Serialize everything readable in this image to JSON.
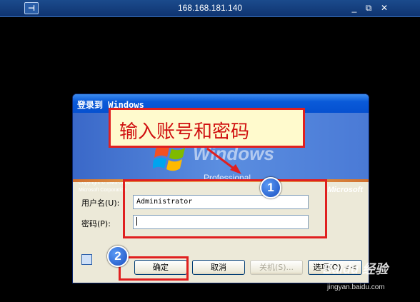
{
  "remote_bar": {
    "host": "168.168.181.140",
    "pin_icon": "pin-icon",
    "minimize_glyph": "_",
    "restore_glyph": "⧉",
    "close_glyph": "✕"
  },
  "dialog": {
    "title": "登录到 Windows",
    "banner": {
      "product_word": "Windows",
      "edition": "Professional",
      "copyright_line1": "Copyright © 1985-2001",
      "copyright_line2": "Microsoft Corporation",
      "brand": "Microsoft"
    },
    "username_label": "用户名(U):",
    "username_value": "Administrator",
    "password_label": "密码(P):",
    "password_value": "",
    "buttons": {
      "ok": "确定",
      "cancel": "取消",
      "shutdown": "关机(S)...",
      "options": "选项(O) <<"
    }
  },
  "annotations": {
    "callout_text": "输入账号和密码",
    "badge_1": "1",
    "badge_2": "2",
    "accent_color": "#e02020"
  },
  "watermark": {
    "brand": "Baidu 经验",
    "url": "jingyan.baidu.com"
  }
}
